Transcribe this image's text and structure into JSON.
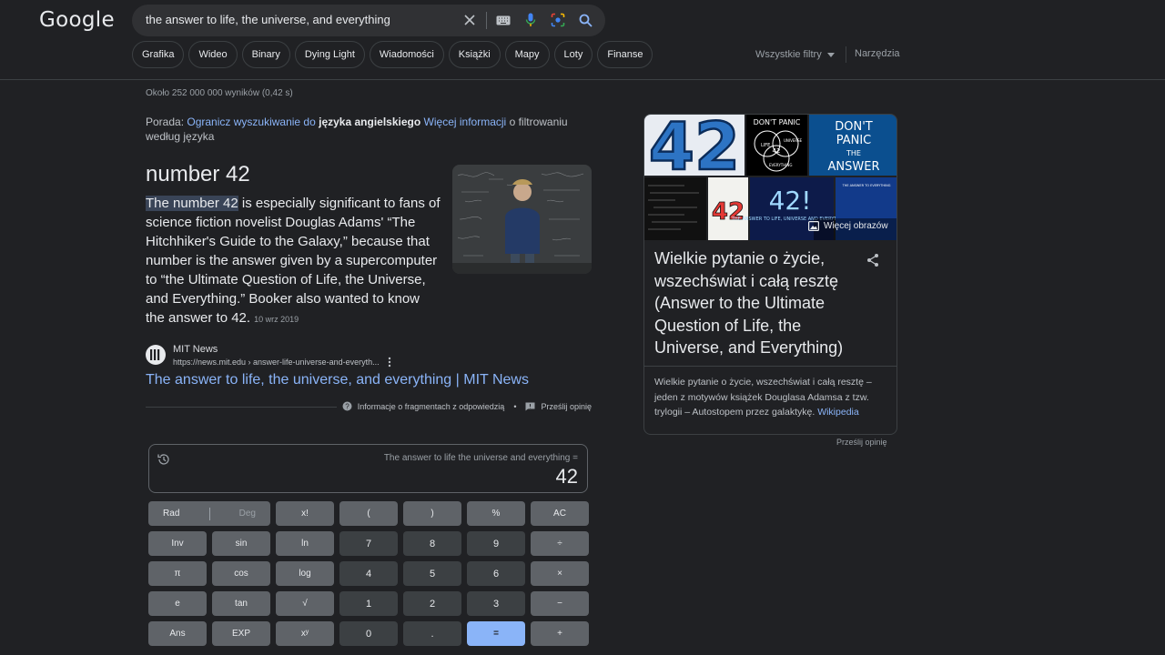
{
  "header": {
    "logo": "Google",
    "search_value": "the answer to life, the universe, and everything",
    "chips": [
      "Grafika",
      "Wideo",
      "Binary",
      "Dying Light",
      "Wiadomości",
      "Książki",
      "Mapy",
      "Loty",
      "Finanse"
    ],
    "filters_label": "Wszystkie filtry",
    "tools_label": "Narzędzia"
  },
  "results": {
    "stats": "Około 252 000 000 wyników (0,42 s)",
    "tip_prefix": "Porada:",
    "tip_link1": "Ogranicz wyszukiwanie do",
    "tip_bold": "języka angielskiego",
    "tip_link2": "Więcej informacji",
    "tip_suffix": "o filtrowaniu według języka"
  },
  "snippet": {
    "title": "number 42",
    "highlight": "The number 42",
    "body": " is especially significant to fans of science fiction novelist Douglas Adams' “The Hitchhiker's Guide to the Galaxy,” because that number is the answer given by a supercomputer to “the Ultimate Question of Life, the Universe, and Everything.” Booker also wanted to know the answer to 42.",
    "date": "10 wrz 2019",
    "source_name": "MIT News",
    "source_url": "https://news.mit.edu › answer-life-universe-and-everyth...",
    "result_title": "The answer to life, the universe, and everything | MIT News",
    "about_label": "Informacje o fragmentach z odpowiedzią",
    "feedback_label": "Prześlij opinię"
  },
  "knowledge_panel": {
    "title": "Wielkie pytanie o życie, wszechświat i całą resztę (Answer to the Ultimate Question of Life, the Universe, and Everything)",
    "description": "Wielkie pytanie o życie, wszechświat i całą resztę – jeden z motywów książek Douglasa Adamsa z tzw. trylogii – Autostopem przez galaktykę.",
    "source_link": "Wikipedia",
    "more_images": "Więcej obrazów",
    "feedback": "Prześlij opinię",
    "image_texts": {
      "big_number": "42",
      "dont_panic": "DON'T PANIC",
      "venn_life": "LIFE",
      "venn_universe": "UNIVERSE",
      "venn_everything": "EVERYTHING",
      "venn_center": "42",
      "dont": "DON'T",
      "panic": "PANIC",
      "the": "THE",
      "answer": "ANSWER",
      "answer_42": "42!",
      "answer_caption": "THE ANSWER TO LIFE, UNIVERSE AND EVERYTHING",
      "mini_42": "42",
      "mini_caption": "THE ANSWER TO EVERYTHING"
    }
  },
  "calculator": {
    "expression": "The answer to life the universe and everything =",
    "result": "42",
    "rad": "Rad",
    "deg": "Deg",
    "keys": [
      "x!",
      "(",
      ")",
      "%",
      "AC",
      "Inv",
      "sin",
      "ln",
      "7",
      "8",
      "9",
      "÷",
      "π",
      "cos",
      "log",
      "4",
      "5",
      "6",
      "×",
      "e",
      "tan",
      "√",
      "1",
      "2",
      "3",
      "−",
      "Ans",
      "EXP",
      "xʸ",
      "0",
      ".",
      "=",
      "+"
    ]
  },
  "colors": {
    "background": "#202124",
    "link": "#8ab4f8",
    "surface": "#303134",
    "key_fn": "#5f6368",
    "key_num": "#3c4043"
  }
}
